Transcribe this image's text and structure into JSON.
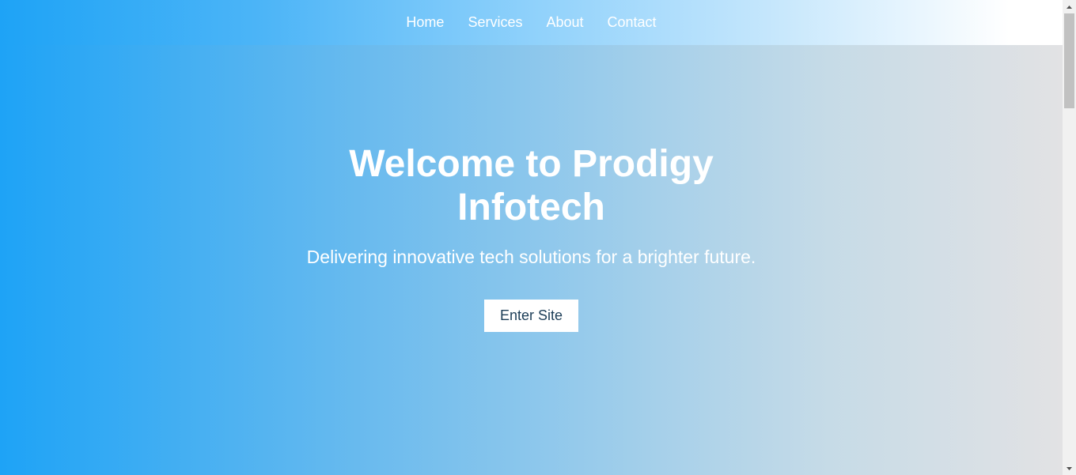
{
  "nav": {
    "items": [
      {
        "label": "Home"
      },
      {
        "label": "Services"
      },
      {
        "label": "About"
      },
      {
        "label": "Contact"
      }
    ]
  },
  "hero": {
    "title_line1": "Welcome to Prodigy",
    "title_line2": "Infotech",
    "subtitle": "Delivering innovative tech solutions for a brighter future.",
    "cta_label": "Enter Site"
  },
  "colors": {
    "gradient_start": "#1ea3f6",
    "gradient_end": "#e2e2e4",
    "button_text": "#1c3d57"
  },
  "icons": {
    "scroll_up": "triangle-up-icon",
    "scroll_down": "triangle-down-icon"
  }
}
